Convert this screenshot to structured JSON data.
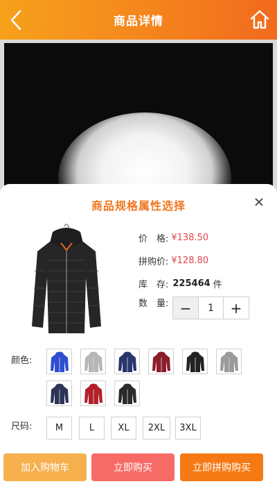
{
  "header": {
    "title": "商品详情"
  },
  "sheet": {
    "title": "商品规格属性选择",
    "price_label": "价　格:",
    "price": "¥138.50",
    "group_price_label": "拼购价:",
    "group_price": "¥128.80",
    "stock_label": "库　存:",
    "stock": "225464",
    "stock_unit": "件",
    "qty_label": "数　量:",
    "qty_minus": "−",
    "qty_value": "1",
    "qty_plus": "+",
    "color_label": "颜色:",
    "colors": [
      {
        "name": "royal-blue",
        "hex": "#2e4fd0"
      },
      {
        "name": "light-gray",
        "hex": "#b6b6b6"
      },
      {
        "name": "navy",
        "hex": "#28366e"
      },
      {
        "name": "wine-red",
        "hex": "#8c1d2b"
      },
      {
        "name": "black",
        "hex": "#222222"
      },
      {
        "name": "silver-gray",
        "hex": "#9a9a9a"
      },
      {
        "name": "dark-navy",
        "hex": "#2c3558"
      },
      {
        "name": "red",
        "hex": "#b3202a"
      },
      {
        "name": "black-2",
        "hex": "#2a2a2a"
      }
    ],
    "size_label": "尺码:",
    "sizes": [
      "M",
      "L",
      "XL",
      "2XL",
      "3XL"
    ]
  },
  "actions": {
    "add_cart": "加入购物车",
    "buy_now": "立即购买",
    "group_buy": "立即拼购购买"
  },
  "colors": {
    "header_start": "#f6a11b",
    "header_end": "#f26a1d",
    "accent": "#f0761e",
    "price": "#e0474c",
    "cart_button": "#f7b04e",
    "buy_button": "#f66b66",
    "group_button": "#f57a16"
  }
}
